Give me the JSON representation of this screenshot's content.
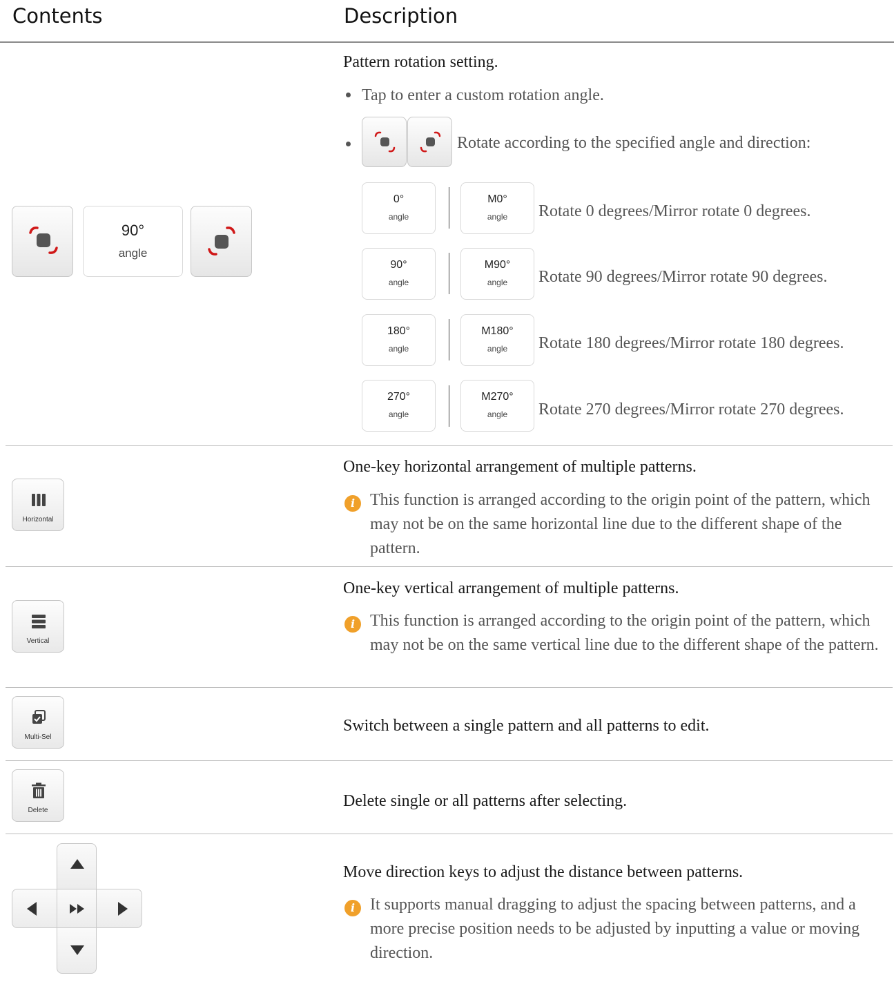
{
  "header": {
    "contents": "Contents",
    "description": "Description"
  },
  "rotation": {
    "angle_value": "90°",
    "angle_unit": "angle",
    "title": "Pattern rotation setting.",
    "bullet1": "Tap to enter a custom rotation angle.",
    "bullet2": "Rotate according to the specified angle and direction:",
    "presets": [
      {
        "a": "0°",
        "m": "M0°",
        "unit": "angle",
        "text": "Rotate 0 degrees/Mirror rotate 0 degrees."
      },
      {
        "a": "90°",
        "m": "M90°",
        "unit": "angle",
        "text": "Rotate 90 degrees/Mirror rotate 90 degrees."
      },
      {
        "a": "180°",
        "m": "M180°",
        "unit": "angle",
        "text": "Rotate 180 degrees/Mirror rotate 180 degrees."
      },
      {
        "a": "270°",
        "m": "M270°",
        "unit": "angle",
        "text": "Rotate 270 degrees/Mirror rotate 270 degrees."
      }
    ],
    "accent_color": "#d01818"
  },
  "horizontal": {
    "label": "Horizontal",
    "title": "One-key horizontal arrangement of multiple patterns.",
    "note": "This function is arranged according to the origin point of the pattern, which may not be on the same horizontal line due to the different shape of the pattern."
  },
  "vertical": {
    "label": "Vertical",
    "title": "One-key vertical arrangement of multiple patterns.",
    "note": "This function is arranged according to the origin point of the pattern, which may not be on the same vertical line due to the different shape of the pattern."
  },
  "multisel": {
    "label": "Multi-Sel",
    "title": "Switch between a single pattern and all patterns to edit."
  },
  "delete": {
    "label": "Delete",
    "title": "Delete single or all patterns after selecting."
  },
  "direction": {
    "title": "Move direction keys to adjust the distance between patterns.",
    "note": "It supports manual dragging to adjust the spacing between patterns, and a more precise position needs to be adjusted by inputting a value or moving direction."
  },
  "info_glyph": "i",
  "info_color": "#f0a02a"
}
